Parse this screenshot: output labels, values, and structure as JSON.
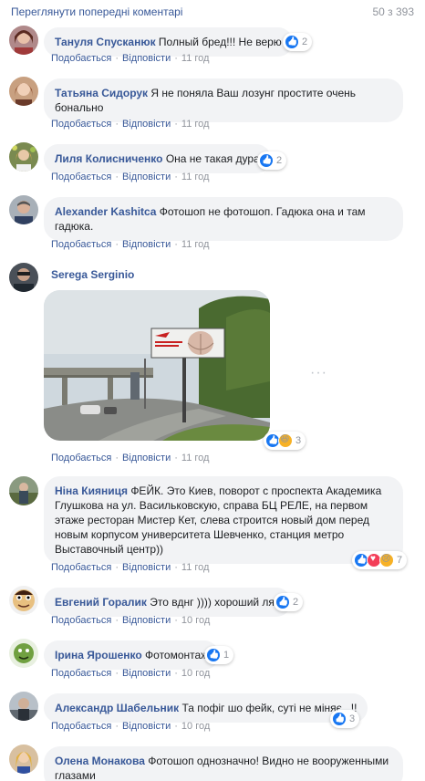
{
  "header": {
    "prev_link": "Переглянути попередні коментарі",
    "counter": "50 з 393"
  },
  "labels": {
    "like": "Подобається",
    "reply": "Відповісти",
    "dot": "·"
  },
  "comments": [
    {
      "author": "Тануля Спусканюк",
      "text": "Полный бред!!! Не верю",
      "time": "11 год",
      "reactions": [
        "like"
      ],
      "count": "2"
    },
    {
      "author": "Татьяна Сидорук",
      "text": "Я не поняла Ваш лозунг простите очень",
      "text2": "бонально",
      "time": "11 год"
    },
    {
      "author": "Лиля Колисниченко",
      "text": "Она не такая дура",
      "time": "11 год",
      "reactions": [
        "like"
      ],
      "count": "2"
    },
    {
      "author": "Alexander Kashitca",
      "text": "Фотошоп не фотошоп. Гадюка она и там",
      "text2": "гадюка.",
      "time": "11 год"
    },
    {
      "author": "Serega Serginio",
      "text": "",
      "time": "11 год",
      "reactions": [
        "like",
        "haha"
      ],
      "count": "3"
    },
    {
      "author": "Ніна Кияниця",
      "text": "ФЕЙК. Это Киев, поворот с проспекта Академика",
      "text2": "Глушкова на ул. Васильковскую, справа БЦ РЕЛЕ, на первом",
      "text3": "этаже ресторан Мистер Кет, слева строится новый дом перед",
      "text4": "новым корпусом университета Шевченко, станция метро",
      "text5": "Выставочный центр))",
      "time": "11 год",
      "reactions": [
        "like",
        "love",
        "sad"
      ],
      "count": "7"
    },
    {
      "author": "Евгений Горалик",
      "text": "Это вднг )))) хороший ляп",
      "time": "10 год",
      "reactions": [
        "like"
      ],
      "count": "2"
    },
    {
      "author": "Ірина Ярошенко",
      "text": "Фотомонтаж",
      "time": "10 год",
      "reactions": [
        "like"
      ],
      "count": "1"
    },
    {
      "author": "Александр Шабельник",
      "text": "Та пофіг шо фейк, суті не міняє...!!",
      "time": "10 год",
      "reactions": [
        "like"
      ],
      "count": "3"
    },
    {
      "author": "Олена Монакова",
      "text": "Фотошоп однозначно! Видно не вооруженными",
      "text2": "глазами"
    }
  ],
  "billboard": {
    "line1": "СЛАВА ДУРА",
    "line2": "ЯКА НЕ ВІРИТЬ"
  },
  "colors": {
    "link": "#385898",
    "bubble": "#f2f3f5",
    "meta": "#90949c",
    "like": "#1877f2"
  }
}
